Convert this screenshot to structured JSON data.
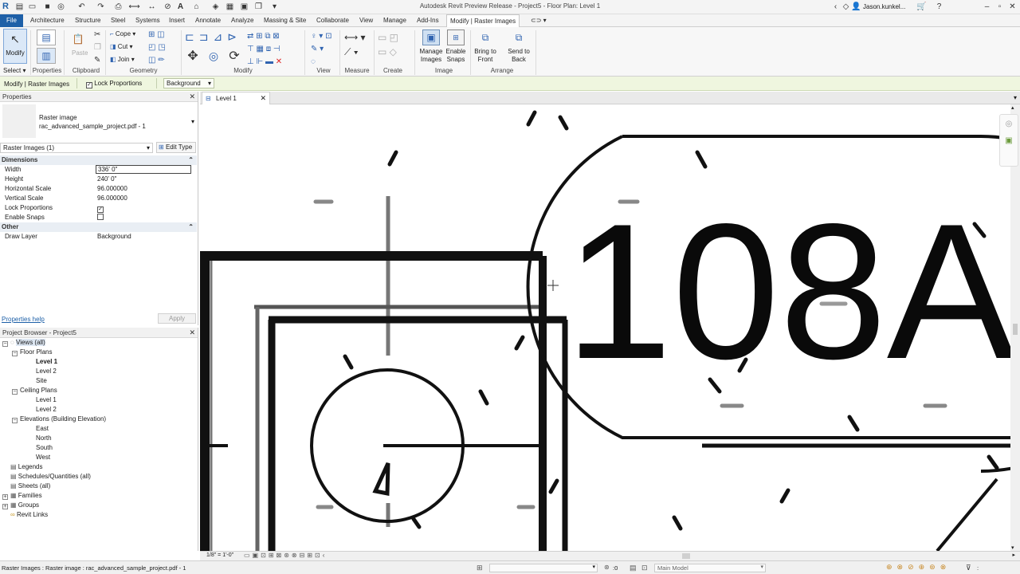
{
  "app": {
    "title": "Autodesk Revit Preview Release - Project5 - Floor Plan: Level 1",
    "user": "Jason.kunkel..."
  },
  "menu": {
    "tabs": [
      "File",
      "Architecture",
      "Structure",
      "Steel",
      "Systems",
      "Insert",
      "Annotate",
      "Analyze",
      "Massing & Site",
      "Collaborate",
      "View",
      "Manage",
      "Add-Ins",
      "Modify | Raster Images"
    ],
    "active": "Modify | Raster Images"
  },
  "ribbon": {
    "modify_label": "Modify",
    "paste_label": "Paste",
    "cope_label": "Cope",
    "cut_label": "Cut",
    "join_label": "Join",
    "panels": {
      "select": "Select",
      "properties": "Properties",
      "clipboard": "Clipboard",
      "geometry": "Geometry",
      "modify": "Modify",
      "view": "View",
      "measure": "Measure",
      "create": "Create",
      "image": "Image",
      "arrange": "Arrange"
    },
    "manage_images": "Manage Images",
    "enable_snaps": "Enable Snaps",
    "bring_to_front": "Bring to Front",
    "send_to_back": "Send to Back"
  },
  "optbar": {
    "context": "Modify | Raster Images",
    "lock_proportions": "Lock Proportions",
    "draw_layer": "Background"
  },
  "properties": {
    "title": "Properties",
    "type_name": "Raster image",
    "type_sub": "rac_advanced_sample_project.pdf - 1",
    "selector": "Raster Images (1)",
    "edit_type": "Edit Type",
    "groups": {
      "dimensions": "Dimensions",
      "other": "Other"
    },
    "rows": {
      "width_k": "Width",
      "width_v": "336' 0\"",
      "height_k": "Height",
      "height_v": "240' 0\"",
      "hscale_k": "Horizontal Scale",
      "hscale_v": "96.000000",
      "vscale_k": "Vertical Scale",
      "vscale_v": "96.000000",
      "lock_k": "Lock Proportions",
      "snaps_k": "Enable Snaps",
      "layer_k": "Draw Layer",
      "layer_v": "Background"
    },
    "help": "Properties help",
    "apply": "Apply"
  },
  "browser": {
    "title": "Project Browser - Project5",
    "root": "Views (all)",
    "floor_plans": "Floor Plans",
    "fp": [
      "Level 1",
      "Level 2",
      "Site"
    ],
    "ceiling": "Ceiling Plans",
    "cp": [
      "Level 1",
      "Level 2"
    ],
    "elev": "Elevations (Building Elevation)",
    "ev": [
      "East",
      "North",
      "South",
      "West"
    ],
    "others": [
      "Legends",
      "Schedules/Quantities (all)",
      "Sheets (all)",
      "Families",
      "Groups",
      "Revit Links"
    ]
  },
  "view": {
    "tab": "Level 1",
    "scale": "1/8\" = 1'-0\"",
    "tag_text": "108A"
  },
  "status": {
    "text": "Raster Images : Raster image : rac_advanced_sample_project.pdf - 1",
    "workset": ":0",
    "model": "Main Model"
  }
}
